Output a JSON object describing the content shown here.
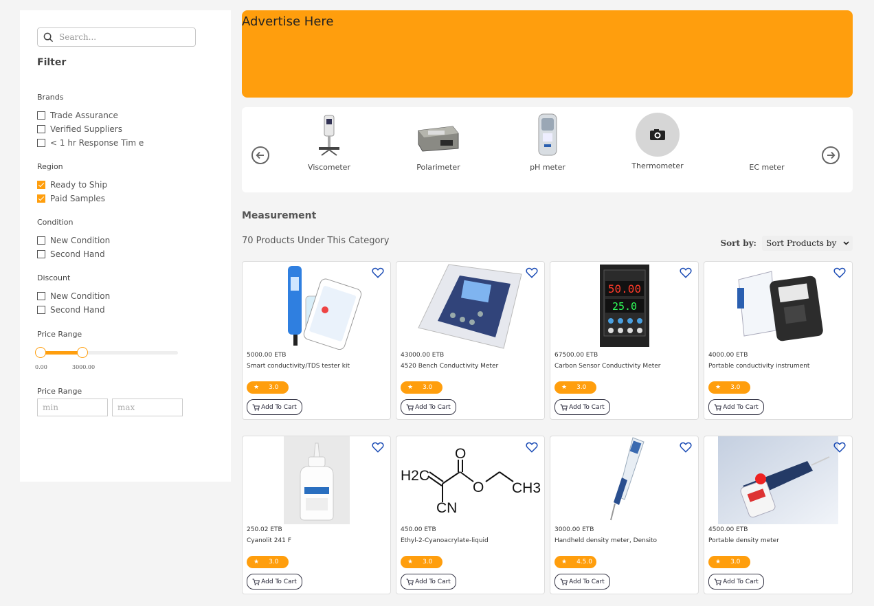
{
  "sidebar": {
    "search_placeholder": "Search...",
    "filter_title": "Filter",
    "groups": [
      {
        "heading": "Brands",
        "options": [
          {
            "label": "Trade Assurance",
            "checked": false
          },
          {
            "label": "Verified Suppliers",
            "checked": false
          },
          {
            "label": "< 1 hr Response Tim e",
            "checked": false
          }
        ]
      },
      {
        "heading": "Region",
        "options": [
          {
            "label": "Ready to Ship",
            "checked": true
          },
          {
            "label": "Paid Samples",
            "checked": true
          }
        ]
      },
      {
        "heading": "Condition",
        "options": [
          {
            "label": "New Condition",
            "checked": false
          },
          {
            "label": "Second Hand",
            "checked": false
          }
        ]
      },
      {
        "heading": "Discount",
        "options": [
          {
            "label": "New Condition",
            "checked": false
          },
          {
            "label": "Second Hand",
            "checked": false
          }
        ]
      }
    ],
    "price_range_title": "Price Range",
    "slider_min_label": "0.00",
    "slider_max_label": "3000.00",
    "price_range_title_2": "Price Range",
    "min_placeholder": "min",
    "max_placeholder": "max"
  },
  "ad": {
    "text": "Advertise Here"
  },
  "categories": [
    {
      "label": "Viscometer",
      "icon": "viscometer-image"
    },
    {
      "label": "Polarimeter",
      "icon": "polarimeter-image"
    },
    {
      "label": "pH meter",
      "icon": "ph-meter-image"
    },
    {
      "label": "Thermometer",
      "icon": "camera-icon"
    },
    {
      "label": "EC meter",
      "icon": ""
    }
  ],
  "section_title": "Measurement",
  "product_count": "70 Products Under This Category",
  "sort": {
    "label": "Sort by:",
    "value": "Sort Products by"
  },
  "add_to_cart_label": "Add To Cart",
  "products": [
    {
      "price": "5000.00 ETB",
      "name": "Smart conductivity/TDS tester kit",
      "rating": "3.0"
    },
    {
      "price": "43000.00 ETB",
      "name": "4520 Bench Conductivity Meter",
      "rating": "3.0"
    },
    {
      "price": "67500.00 ETB",
      "name": "Carbon Sensor Conductivity Meter",
      "rating": "3.0"
    },
    {
      "price": "4000.00 ETB",
      "name": "Portable conductivity instrument",
      "rating": "3.0"
    },
    {
      "price": "250.02 ETB",
      "name": "Cyanolit 241 F",
      "rating": "3.0"
    },
    {
      "price": "450.00 ETB",
      "name": "Ethyl-2-Cyanoacrylate-liquid",
      "rating": "3.0"
    },
    {
      "price": "3000.00 ETB",
      "name": "Handheld density meter, Densito",
      "rating": "4.5.0"
    },
    {
      "price": "4500.00 ETB",
      "name": "Portable density meter",
      "rating": "3.0"
    }
  ],
  "display_labels": {
    "meter_top": "50.00",
    "meter_bottom": "25.0",
    "chem_h2c": "H2C",
    "chem_o": "O",
    "chem_o2": "O",
    "chem_ch3": "CH3",
    "chem_cn": "CN"
  },
  "colors": {
    "accent": "#ff9e0d",
    "heart": "#1a4bb5"
  }
}
